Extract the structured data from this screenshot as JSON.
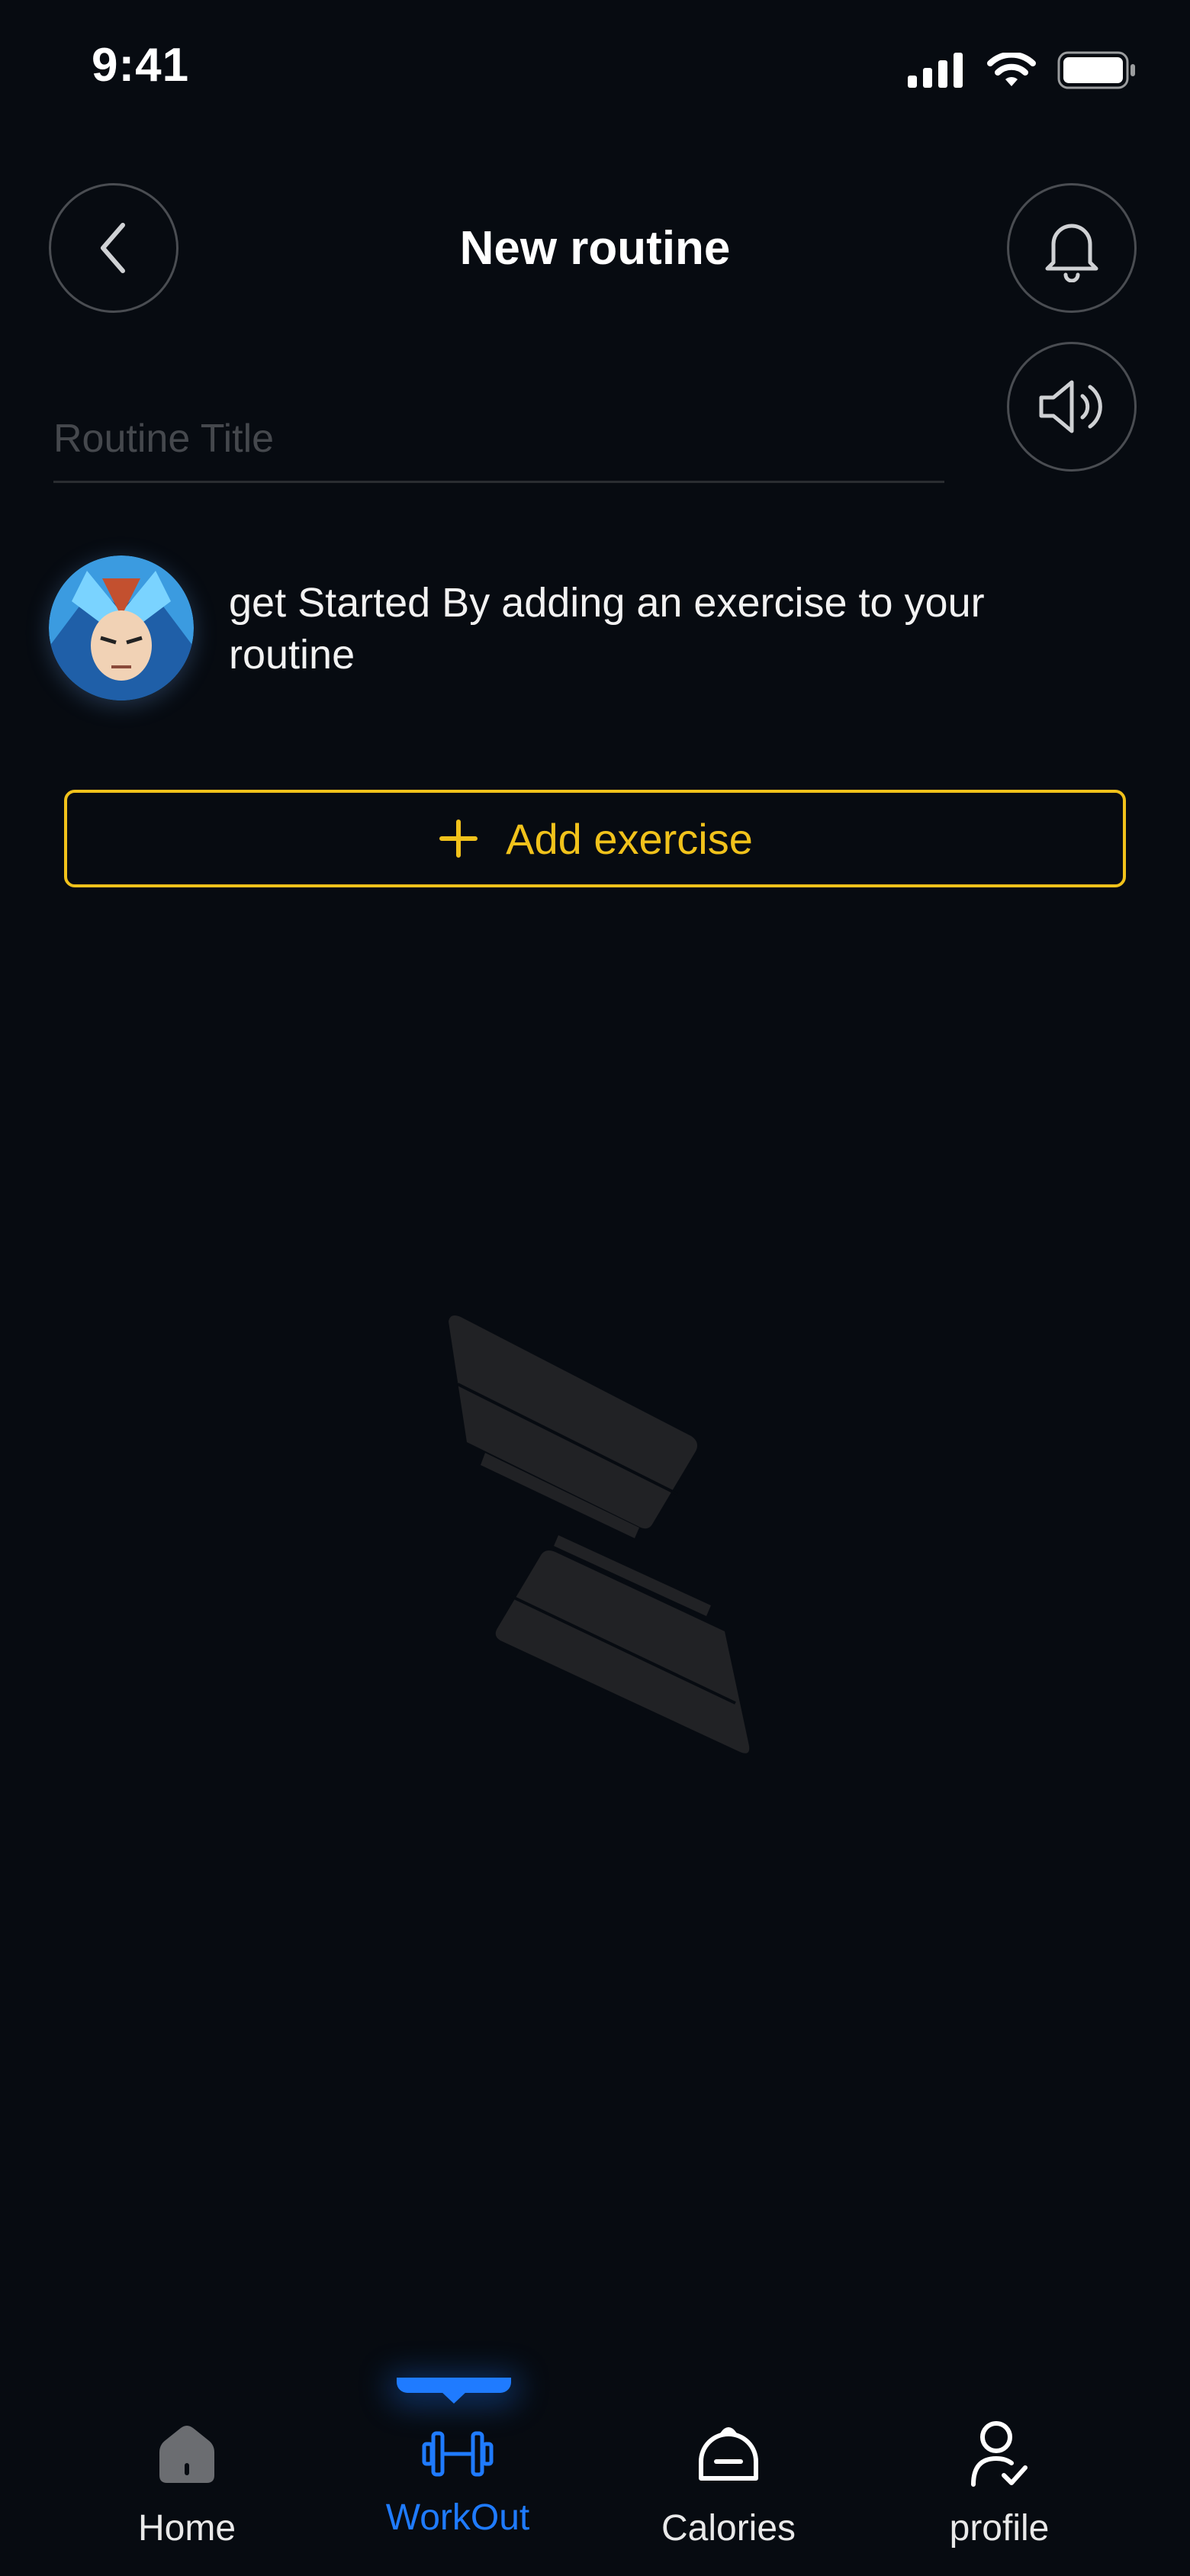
{
  "status_bar": {
    "time": "9:41"
  },
  "header": {
    "title": "New routine"
  },
  "routine_title_input": {
    "value": "",
    "placeholder": "Routine Title"
  },
  "intro": {
    "text": "get Started By adding an exercise to your routine"
  },
  "add_exercise": {
    "label": "Add exercise",
    "icon": "plus-icon"
  },
  "nav": {
    "items": [
      {
        "label": "Home",
        "icon": "home-icon"
      },
      {
        "label": "WorkOut",
        "icon": "dumbbell-icon",
        "active": true
      },
      {
        "label": "Calories",
        "icon": "bell-food-icon"
      },
      {
        "label": "profile",
        "icon": "profile-check-icon"
      }
    ]
  },
  "colors": {
    "background": "#070b11",
    "accent_yellow": "#f1c21b",
    "active_blue": "#1f7bff",
    "border_gray": "#4a4d52"
  }
}
